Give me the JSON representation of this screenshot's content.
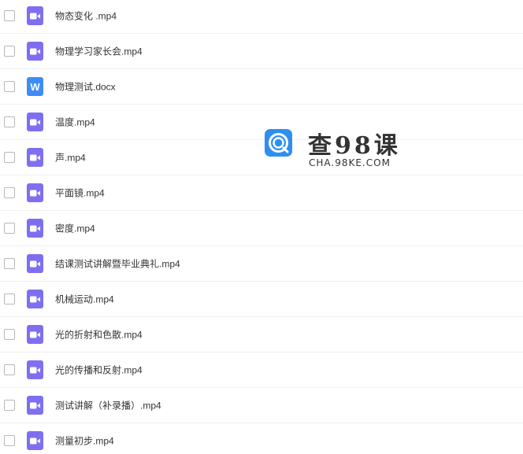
{
  "files": [
    {
      "name": "物态变化 .mp4",
      "type": "video"
    },
    {
      "name": "物理学习家长会.mp4",
      "type": "video"
    },
    {
      "name": "物理测试.docx",
      "type": "word"
    },
    {
      "name": "温度.mp4",
      "type": "video"
    },
    {
      "name": "声.mp4",
      "type": "video"
    },
    {
      "name": "平面镜.mp4",
      "type": "video"
    },
    {
      "name": "密度.mp4",
      "type": "video"
    },
    {
      "name": "结课测试讲解暨毕业典礼.mp4",
      "type": "video"
    },
    {
      "name": "机械运动.mp4",
      "type": "video"
    },
    {
      "name": "光的折射和色散.mp4",
      "type": "video"
    },
    {
      "name": "光的传播和反射.mp4",
      "type": "video"
    },
    {
      "name": "测试讲解（补录播）.mp4",
      "type": "video"
    },
    {
      "name": "测量初步.mp4",
      "type": "video"
    }
  ],
  "icons": {
    "video": "video-file-icon",
    "word": "word-file-icon",
    "word_letter": "W"
  },
  "watermark": {
    "title": "查98课",
    "url": "CHA.98KE.COM"
  },
  "colors": {
    "video_icon": "#7e6ff0",
    "word_icon": "#3f8cf7",
    "watermark_logo": "#2f8ff0"
  }
}
